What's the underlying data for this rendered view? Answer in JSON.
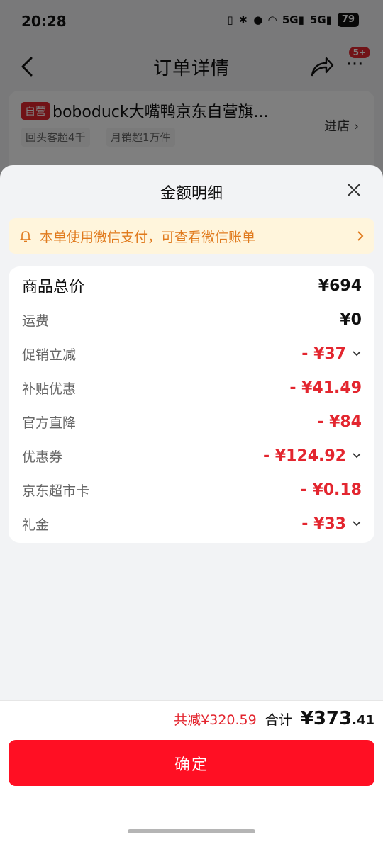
{
  "status_bar": {
    "time": "20:28",
    "battery": "79",
    "signal_a": "5G",
    "signal_b": "5G"
  },
  "nav": {
    "title": "订单详情",
    "more_badge": "5+"
  },
  "store": {
    "tag": "自营",
    "name": "boboduck大嘴鸭京东自营旗...",
    "enter_label": "进店",
    "chips": [
      "回头客超4千",
      "月销超1万件"
    ]
  },
  "sheet": {
    "title": "金额明细",
    "notice": "本单使用微信支付，可查看微信账单",
    "rows": [
      {
        "label": "商品总价",
        "value": "¥694"
      },
      {
        "label": "运费",
        "value": "¥0"
      },
      {
        "label": "促销立减",
        "value": "- ¥37"
      },
      {
        "label": "补贴优惠",
        "value": "- ¥41.49"
      },
      {
        "label": "官方直降",
        "value": "- ¥84"
      },
      {
        "label": "优惠券",
        "value": "- ¥124.92"
      },
      {
        "label": "京东超市卡",
        "value": "- ¥0.18"
      },
      {
        "label": "礼金",
        "value": "- ¥33"
      }
    ]
  },
  "footer": {
    "saved": "共减¥320.59",
    "total_label": "合计",
    "total_currency": "¥",
    "total_integer": "373",
    "total_cents": ".41",
    "confirm_label": "确定"
  },
  "colors": {
    "accent": "#ff0f23",
    "discount": "#e3262f",
    "notice_bg": "#fff5dc",
    "notice_text": "#e07a1d"
  }
}
